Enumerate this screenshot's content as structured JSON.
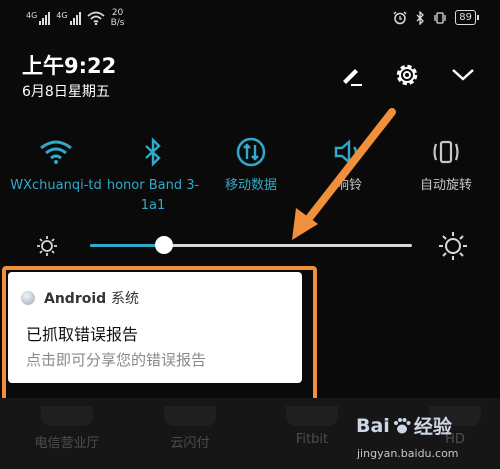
{
  "status_bar": {
    "sim1_label": "4G",
    "sim2_label": "4G",
    "net_speed_value": "20",
    "net_speed_unit": "B/s",
    "battery": "89"
  },
  "header": {
    "time": "上午9:22",
    "date": "6月8日星期五"
  },
  "quick_tiles": [
    {
      "label": "WXchuanqi-td",
      "icon": "wifi-icon",
      "active": true
    },
    {
      "label": "honor Band 3-1a1",
      "icon": "bluetooth-icon",
      "active": true
    },
    {
      "label": "移动数据",
      "icon": "mobile-data-icon",
      "active": true
    },
    {
      "label": "响铃",
      "icon": "speaker-icon",
      "active": false
    },
    {
      "label": "自动旋转",
      "icon": "rotate-icon",
      "active": false
    }
  ],
  "brightness": {
    "level": 0.23
  },
  "notification": {
    "app": "Android",
    "app_suffix": "系统",
    "title": "已抓取错误报告",
    "body": "点击即可分享您的错误报告"
  },
  "dock_apps": [
    {
      "label": "电信营业厅"
    },
    {
      "label": "云闪付"
    },
    {
      "label": "Fitbit"
    },
    {
      "label": "HD"
    }
  ],
  "watermark": {
    "brand": "Bai",
    "brand_suffix": "经验",
    "url": "jingyan.baidu.com"
  },
  "colors": {
    "accent": "#31a9c8",
    "annotation": "#f0903b"
  }
}
